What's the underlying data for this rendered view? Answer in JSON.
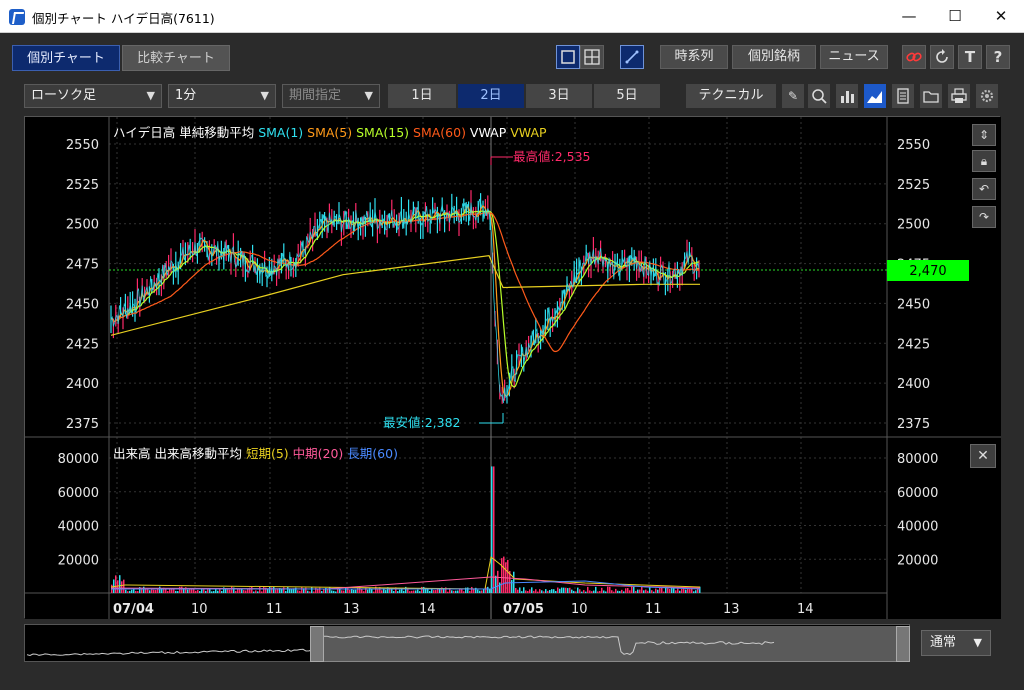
{
  "window": {
    "title": "個別チャート ハイデ日高(7611)",
    "min_label": "—",
    "max_label": "☐",
    "close_label": "✕"
  },
  "tabs": [
    {
      "label": "個別チャート"
    },
    {
      "label": "比較チャート"
    }
  ],
  "header_buttons": {
    "jikeiretsu": "時系列",
    "kobetsu": "個別銘柄",
    "news": "ニュース"
  },
  "toolbar": {
    "chart_type": "ローソク足",
    "interval": "1分",
    "period": "期間指定",
    "days": [
      "1日",
      "2日",
      "3日",
      "5日"
    ],
    "days_selected": "2日",
    "technical": "テクニカル"
  },
  "price_panel": {
    "legend": [
      {
        "text": "ハイデ日高 単純移動平均",
        "color": "#ffffff"
      },
      {
        "text": "SMA(1)",
        "color": "#2fe0f0"
      },
      {
        "text": "SMA(5)",
        "color": "#ff9a1a"
      },
      {
        "text": "SMA(15)",
        "color": "#b8ff2a"
      },
      {
        "text": "SMA(60)",
        "color": "#ff5a1a"
      },
      {
        "text": "VWAP",
        "color": "#ffffff"
      },
      {
        "text": "VWAP",
        "color": "#e8d020"
      }
    ],
    "ticks": [
      "2550",
      "2525",
      "2500",
      "2475",
      "2450",
      "2425",
      "2400",
      "2375"
    ],
    "high_label": "最高値:2,535",
    "low_label": "最安値:2,382",
    "current_price": "2,470"
  },
  "volume_panel": {
    "legend": [
      {
        "text": "出来高 出来高移動平均",
        "color": "#ffffff"
      },
      {
        "text": "短期(5)",
        "color": "#e8d020"
      },
      {
        "text": "中期(20)",
        "color": "#ff5a9a"
      },
      {
        "text": "長期(60)",
        "color": "#4a8aff"
      }
    ],
    "ticks": [
      "80000",
      "60000",
      "40000",
      "20000"
    ]
  },
  "time_axis": [
    "07/04",
    "10",
    "11",
    "13",
    "14",
    "07/05",
    "10",
    "11",
    "13",
    "14"
  ],
  "navigator": {
    "mode": "通常"
  },
  "colors": {
    "tab_active": "#0d2a6e",
    "price_tag": "#00ff00",
    "high": "#ff2a6a",
    "low": "#2fe0f0"
  },
  "chart_data": [
    {
      "type": "line",
      "title": "ハイデ日高 単純移動平均",
      "series": [
        {
          "name": "SMA(1)",
          "x": [
            "07/04 09:00",
            "07/04 10:00",
            "07/04 11:00",
            "07/04 13:00",
            "07/04 14:00",
            "07/04 15:00",
            "07/05 09:00",
            "07/05 09:30",
            "07/05 10:00",
            "07/05 10:30",
            "07/05 11:00",
            "07/05 11:30",
            "07/05 13:00"
          ],
          "values": [
            2438,
            2480,
            2468,
            2500,
            2502,
            2510,
            2392,
            2425,
            2462,
            2480,
            2473,
            2468,
            2470
          ]
        },
        {
          "name": "VWAP",
          "x": [
            "07/04 09:00",
            "07/04 11:00",
            "07/04 13:00",
            "07/04 15:00",
            "07/05 09:00",
            "07/05 11:00",
            "07/05 13:00"
          ],
          "values": [
            2430,
            2455,
            2468,
            2480,
            2460,
            2462,
            2462
          ]
        }
      ],
      "high": 2535,
      "low": 2382,
      "last": 2470,
      "ylim": [
        2370,
        2560
      ],
      "yticks": [
        2550,
        2525,
        2500,
        2475,
        2450,
        2425,
        2400,
        2375
      ]
    },
    {
      "type": "bar",
      "title": "出来高",
      "peak": {
        "x": "07/05 09:00",
        "value": 75000
      },
      "ylim": [
        0,
        85000
      ],
      "yticks": [
        80000,
        60000,
        40000,
        20000
      ]
    }
  ]
}
